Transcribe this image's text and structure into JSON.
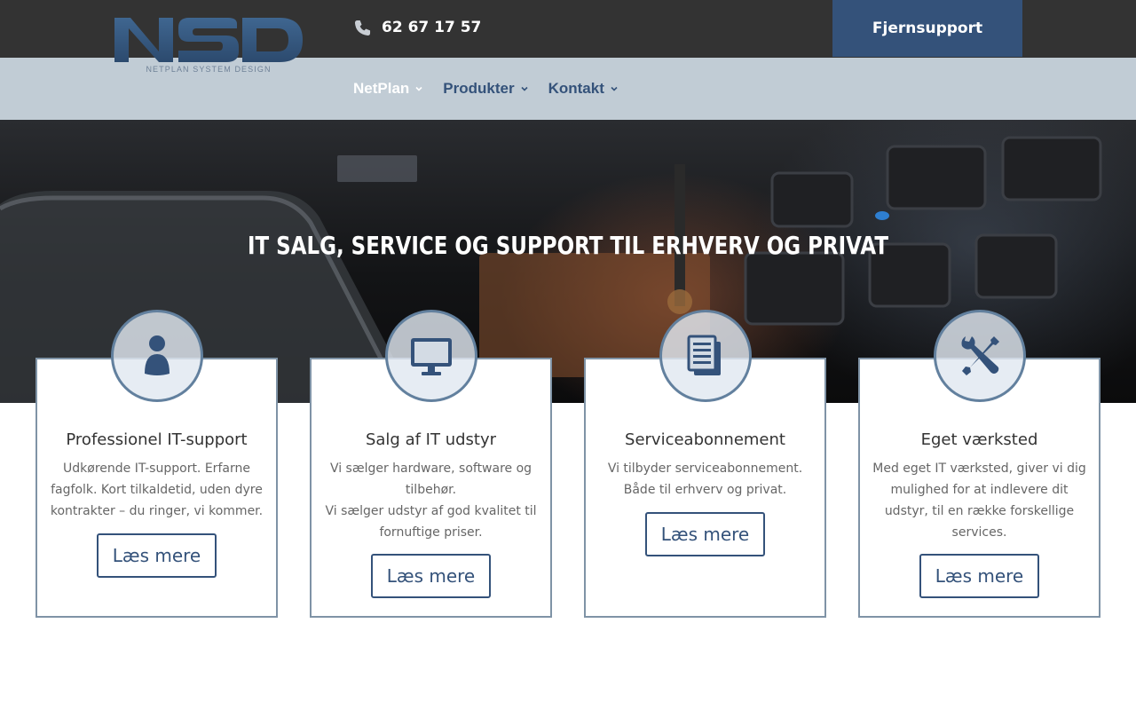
{
  "header": {
    "logo_text": "NSD",
    "logo_tagline": "NETPLAN SYSTEM DESIGN",
    "phone_icon": "phone-icon",
    "phone": "62 67 17 57",
    "remote_support": "Fjernsupport"
  },
  "menu": [
    {
      "label": "NetPlan",
      "active": true
    },
    {
      "label": "Produkter",
      "active": false
    },
    {
      "label": "Kontakt",
      "active": false
    }
  ],
  "hero": {
    "title": "IT SALG, SERVICE OG SUPPORT TIL ERHVERV OG PRIVAT"
  },
  "cards": [
    {
      "icon": "person-icon",
      "title": "Professionel IT-support",
      "lines": [
        "Udkørende IT-support. Erfarne fagfolk. Kort tilkaldetid, uden dyre kontrakter – du ringer, vi kommer."
      ],
      "button": "Læs mere"
    },
    {
      "icon": "monitor-icon",
      "title": "Salg af IT udstyr",
      "lines": [
        "Vi sælger hardware, software og tilbehør.",
        "Vi sælger udstyr af god kvalitet til fornuftige priser."
      ],
      "button": "Læs mere"
    },
    {
      "icon": "documents-icon",
      "title": "Serviceabonnement",
      "lines": [
        "Vi tilbyder serviceabonnement. Både til erhverv og privat."
      ],
      "button": "Læs mere"
    },
    {
      "icon": "tools-icon",
      "title": "Eget værksted",
      "lines": [
        "Med eget IT værksted, giver vi dig mulighed for at indlevere dit udstyr, til en række forskellige services."
      ],
      "button": "Læs mere"
    }
  ],
  "colors": {
    "top_bar": "#333333",
    "nav_bar": "#c1ccd5",
    "brand_blue": "#34527a",
    "card_border": "#7f93a6"
  }
}
